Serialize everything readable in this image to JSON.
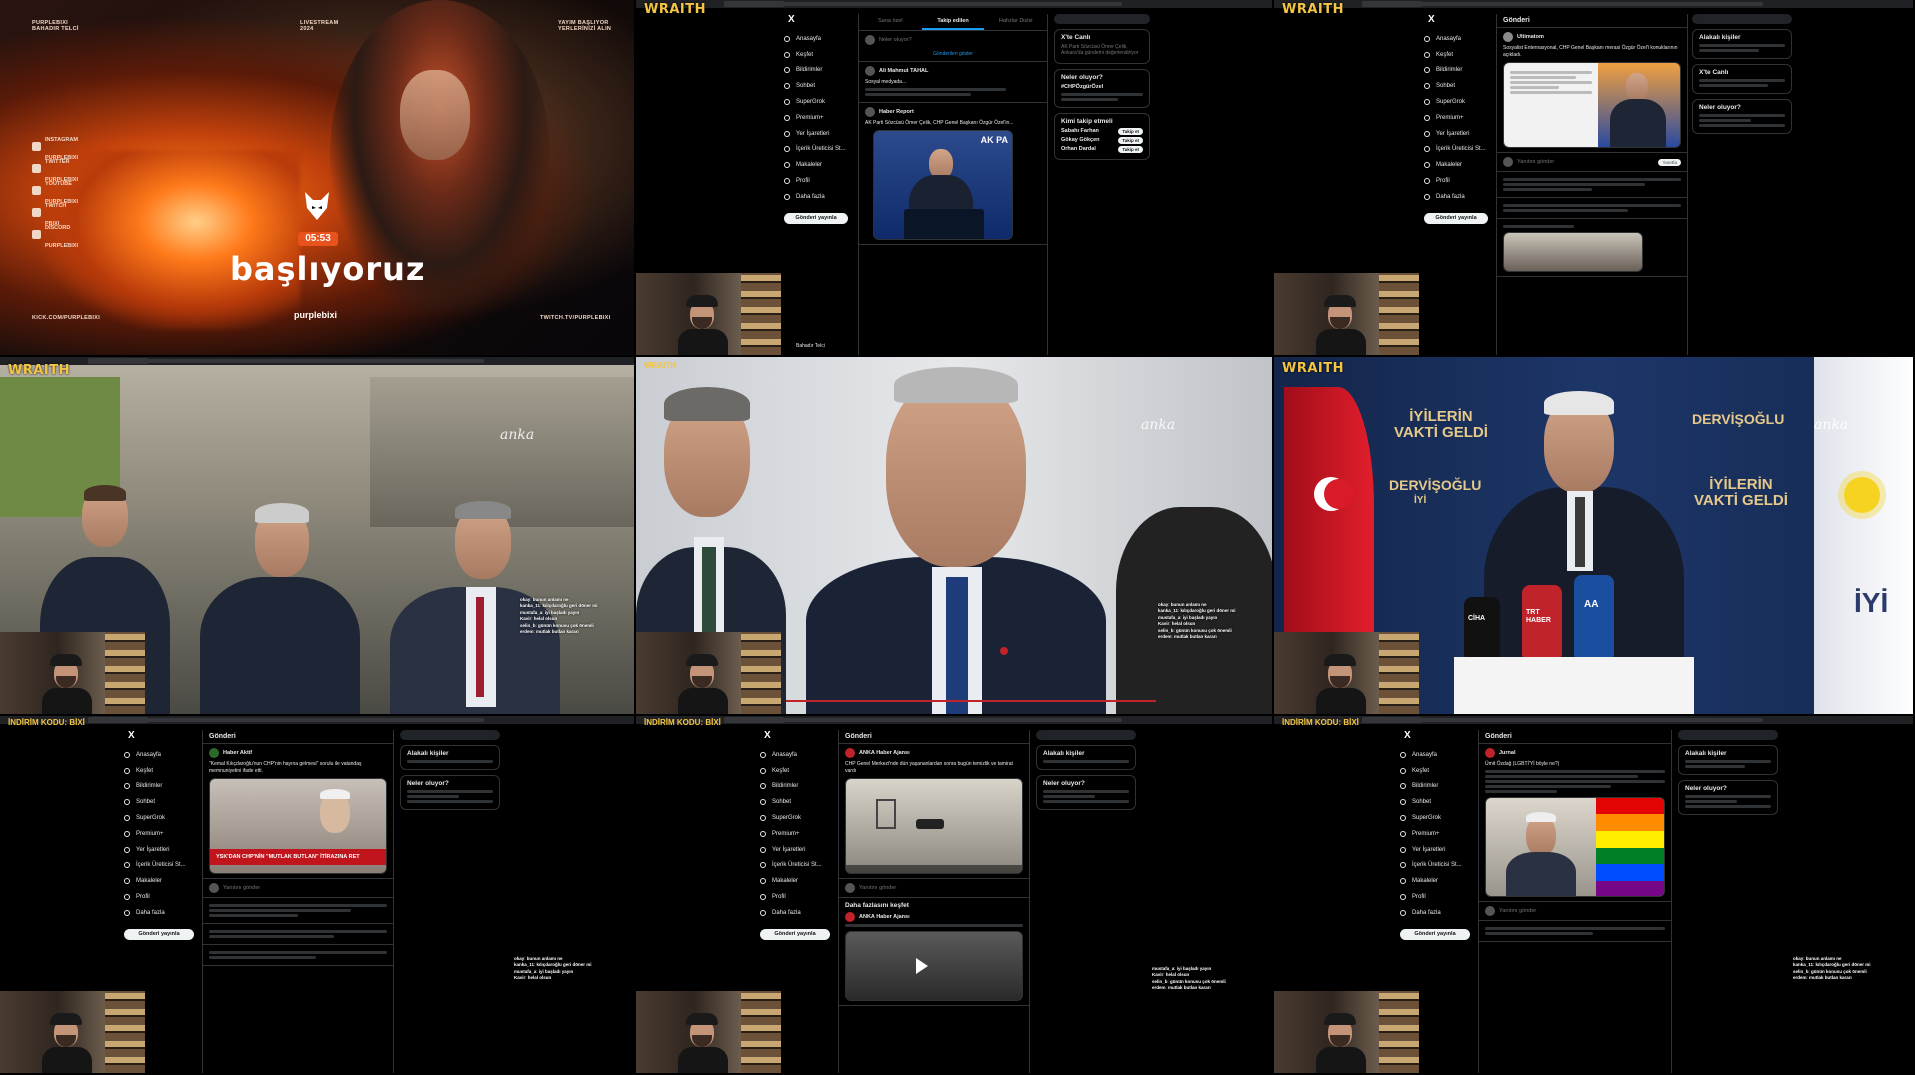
{
  "tile1": {
    "brand_top_left": [
      "PURPLEBIXI",
      "BAHADIR TELCİ"
    ],
    "brand_top_center": [
      "LIVESTREAM",
      "2024"
    ],
    "brand_top_right": [
      "YAYIM BAŞLIYOR",
      "YERLERİNİZİ ALIN"
    ],
    "socials": [
      {
        "icon": "instagram-icon",
        "platform": "INSTAGRAM",
        "handle": "PURPLEBIXI"
      },
      {
        "icon": "twitter-icon",
        "platform": "TWITTER",
        "handle": "PURPLEBIXI"
      },
      {
        "icon": "youtube-icon",
        "platform": "YOUTUBE",
        "handle": "PURPLEBIXI"
      },
      {
        "icon": "twitch-icon",
        "platform": "TWITCH",
        "handle": "PBIXI"
      },
      {
        "icon": "discord-icon",
        "platform": "DISCORD",
        "handle": "PURPLEBIXI"
      }
    ],
    "timer": "05:53",
    "headline": "başlıyoruz",
    "brand_bottom": "purplebixi",
    "footer_left": "KICK.COM/PURPLEBIXI",
    "footer_right": "TWITCH.TV/PURPLEBIXI"
  },
  "overlay": {
    "wraith": "WRAITH",
    "promo": "İNDİRİM KODU: BİXİ"
  },
  "x_nav": {
    "logo": "X",
    "items": [
      "Anasayfa",
      "Keşfet",
      "Bildirimler",
      "Sohbet",
      "SuperGrok",
      "Premium+",
      "Yer İşaretleri",
      "İçerik Üreticisi St...",
      "Makaleler",
      "Profil",
      "Daha fazla"
    ],
    "post_button": "Gönderi yayınla",
    "account": "Bahadır Telci"
  },
  "tile2": {
    "tabs": [
      "Sana özel",
      "Takip edilen",
      "Hafızlar Dizisi"
    ],
    "compose_placeholder": "Neler oluyor?",
    "new_posts": "Gönderileri göster",
    "posts": [
      {
        "name": "Ali Mahmut TAHAL",
        "text": "Sosyal medyada..."
      },
      {
        "name": "Haber Report",
        "text": "AK Parti Sözcüsü Ömer Çelik, CHP Genel Başkanı Özgür Özel'in..."
      }
    ],
    "media_tag": "AK PA",
    "side_title": "X'te Canlı",
    "side_live": "AK Parti Sözcüsü Ömer Çelik, Ankara'da gündemi değerlendiriyor",
    "happening": "Neler oluyor?",
    "hashtag": "#CHPÖzgürÖzel",
    "who_to_follow": "Kimi takip etmeli",
    "follow": "Takip et",
    "suggestions": [
      "Sabahı Farhan",
      "Gökay Gökçen",
      "Orhan Dardal"
    ]
  },
  "tile3": {
    "header": "Gönderi",
    "author": "Ultimatom",
    "text": "Sosyalist Enternasyonal, CHP Genel Başkanı merasi Özgür Özel'i konuklarının açıkladı.",
    "reply_placeholder": "Yanıtını gönder",
    "reply_button": "Yanıtla",
    "relevant": "Alakalı kişiler",
    "live": "X'te Canlı",
    "happening": "Neler oluyor?"
  },
  "tile6": {
    "slogan": [
      "İYİLERİN",
      "VAKTİ GELDİ"
    ],
    "name": "DERVİŞOĞLU",
    "party": "İYİ",
    "mics": [
      "CİHA",
      "TRT HABER",
      "AA"
    ]
  },
  "tile7": {
    "author": "Haber Aktif",
    "text": "\"Kemal Kılıçdaroğlu'nun CHP'nin hayına gelmesi\" sorulu ile vatandaş memnuniyetini ifade etti.",
    "banner": "YSK'DAN CHP'NİN \"MUTLAK BUTLAN\" İTİRAZINA RET",
    "relevant": "Alakalı kişiler",
    "happening": "Neler oluyor?",
    "reply_placeholder": "Yanıtını gönder"
  },
  "tile8": {
    "author": "ANKA Haber Ajansı",
    "text": "CHP Genel Merkezi'nde dün yaşananlardan sonra bugün temizlik ve tamirat vardı",
    "more": "Daha fazlasını keşfet",
    "relevant": "Alakalı kişiler",
    "happening": "Neler oluyor?",
    "reply_placeholder": "Yanıtını gönder"
  },
  "tile9": {
    "author": "Jurnal",
    "text": "Ümit Özdağ (LGBTİ'Yİ böyle ne?)",
    "relevant": "Alakalı kişiler",
    "happening": "Neler oluyor?",
    "reply_placeholder": "Yanıtını gönder"
  },
  "chat_lines": [
    {
      "user": "okay",
      "msg": "bunun anlamı ne"
    },
    {
      "user": "kanka_11",
      "msg": "kılıçdaroğlu geri döner mi"
    },
    {
      "user": "mustafa_a",
      "msg": "iyi başladı yayın"
    },
    {
      "user": "Kavir",
      "msg": "helal olsun"
    },
    {
      "user": "selin_b",
      "msg": "günün konusu çok önemli"
    },
    {
      "user": "erdem",
      "msg": "mutlak butlan kararı"
    }
  ],
  "colors": {
    "accent": "#1d9bf0",
    "wraith": "#f4c542",
    "timer": "#e8521c",
    "x_bg": "#000000"
  }
}
